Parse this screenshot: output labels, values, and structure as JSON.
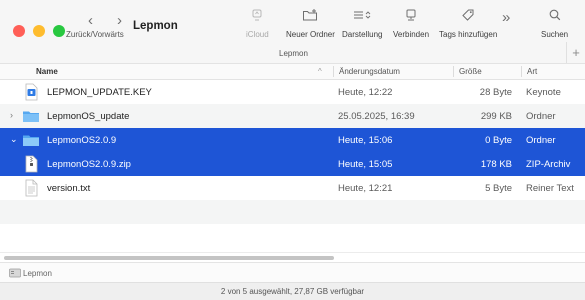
{
  "window": {
    "title": "Lepmon"
  },
  "toolbar": {
    "nav_label": "Zurück/Vorwärts",
    "back_glyph": "‹",
    "forward_glyph": "›",
    "icloud_label": "iCloud",
    "new_folder_label": "Neuer Ordner",
    "view_label": "Darstellung",
    "connect_label": "Verbinden",
    "tags_label": "Tags hinzufügen",
    "more_glyph": "»",
    "search_label": "Suchen",
    "group_label": "Lepmon",
    "plus_glyph": "+"
  },
  "columns": {
    "name": "Name",
    "modified": "Änderungsdatum",
    "size": "Größe",
    "kind": "Art",
    "sort_glyph": "^"
  },
  "rows": [
    {
      "name": "LEPMON_UPDATE.KEY",
      "modified": "Heute, 12:22",
      "size": "28 Byte",
      "kind": "Keynote",
      "icon": "keynote-file-icon",
      "disclosure": "",
      "selected": false
    },
    {
      "name": "LepmonOS_update",
      "modified": "25.05.2025, 16:39",
      "size": "299 KB",
      "kind": "Ordner",
      "icon": "folder-icon",
      "disclosure": "›",
      "selected": false
    },
    {
      "name": "LepmonOS2.0.9",
      "modified": "Heute, 15:06",
      "size": "0 Byte",
      "kind": "Ordner",
      "icon": "folder-icon",
      "disclosure": "⌄",
      "selected": true
    },
    {
      "name": "LepmonOS2.0.9.zip",
      "modified": "Heute, 15:05",
      "size": "178 KB",
      "kind": "ZIP-Archiv",
      "icon": "zip-file-icon",
      "disclosure": "",
      "selected": true
    },
    {
      "name": "version.txt",
      "modified": "Heute, 12:21",
      "size": "5 Byte",
      "kind": "Reiner Text",
      "icon": "text-file-icon",
      "disclosure": "",
      "selected": false
    }
  ],
  "pathbar": {
    "label": "Lepmon"
  },
  "statusbar": {
    "text": "2 von 5 ausgewählt, 27,87 GB verfügbar"
  },
  "colors": {
    "selection": "#1e55d6",
    "folder": "#56a8f0"
  }
}
